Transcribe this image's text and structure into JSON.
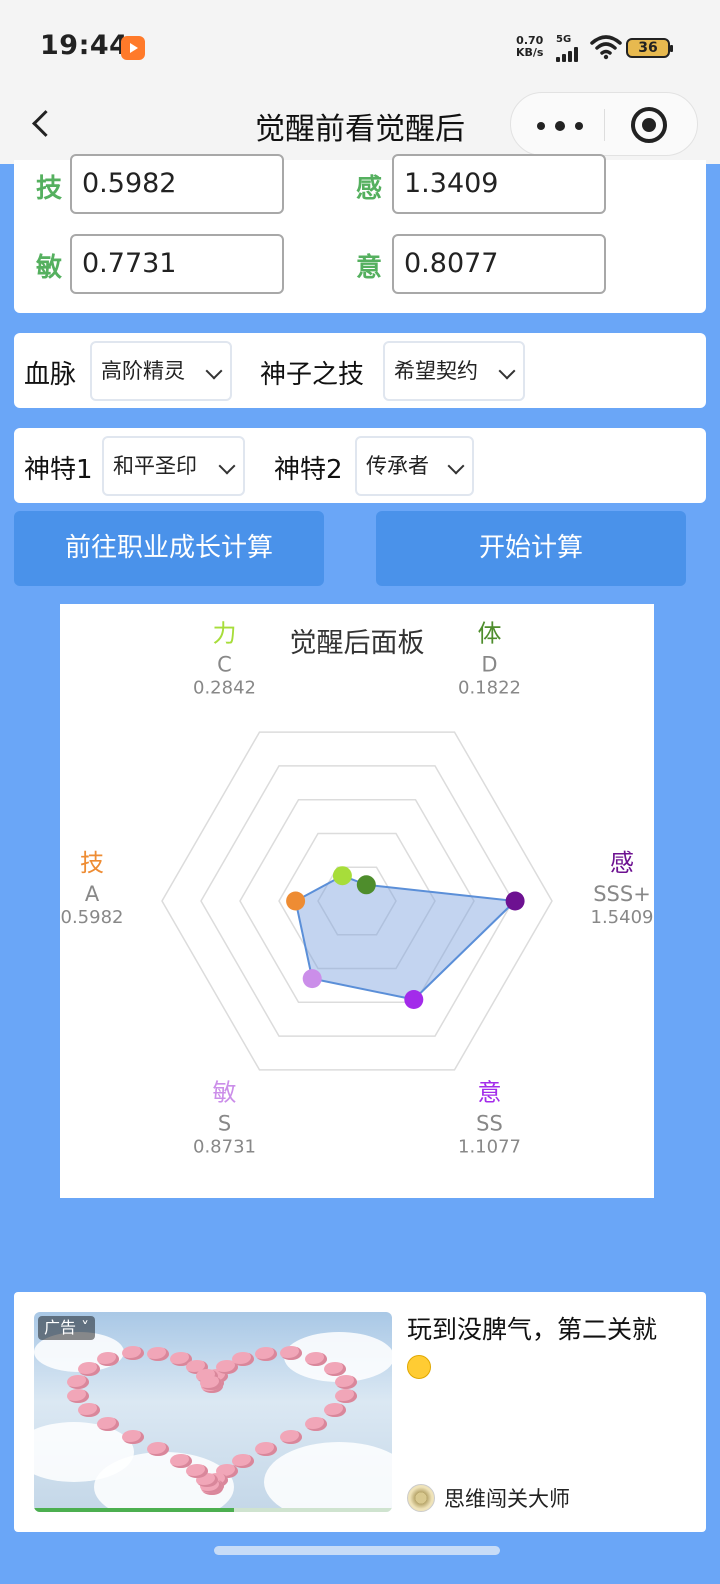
{
  "status_bar": {
    "time": "19:44",
    "net_speed_value": "0.70",
    "net_speed_unit": "KB/s",
    "signal": "5G",
    "battery": "36"
  },
  "nav": {
    "title": "觉醒前看觉醒后",
    "more_icon": "more-dots-icon",
    "close_icon": "target-close-icon"
  },
  "stats": {
    "skill": {
      "label": "技",
      "value": "0.5982"
    },
    "sense": {
      "label": "感",
      "value": "1.3409"
    },
    "agility": {
      "label": "敏",
      "value": "0.7731"
    },
    "will": {
      "label": "意",
      "value": "0.8077"
    }
  },
  "bloodline": {
    "label": "血脉",
    "value": "高阶精灵",
    "skill_label": "神子之技",
    "skill_value": "希望契约"
  },
  "traits": {
    "trait1_label": "神特1",
    "trait1_value": "和平圣印",
    "trait2_label": "神特2",
    "trait2_value": "传承者"
  },
  "buttons": {
    "career": "前往职业成长计算",
    "calculate": "开始计算"
  },
  "chart_data": {
    "type": "radar",
    "title": "觉醒后面板",
    "axes": [
      {
        "name": "力",
        "grade": "C",
        "value": 0.2842,
        "color": "#a7dd3a"
      },
      {
        "name": "体",
        "grade": "D",
        "value": 0.1822,
        "color": "#4e8d2c"
      },
      {
        "name": "感",
        "grade": "SSS+",
        "value": 1.5409,
        "color": "#6d1191"
      },
      {
        "name": "意",
        "grade": "SS",
        "value": 1.1077,
        "color": "#a32bea"
      },
      {
        "name": "敏",
        "grade": "S",
        "value": 0.8731,
        "color": "#cb8ee9"
      },
      {
        "name": "技",
        "grade": "A",
        "value": 0.5982,
        "color": "#ee8c33"
      }
    ],
    "max": 1.9,
    "rings": 5,
    "grid": true,
    "fill_color": "#7a9fdd"
  },
  "ad": {
    "tag": "广告",
    "headline": "玩到没脾气，第二关就",
    "source": "思维闯关大师",
    "progress": 0.56
  }
}
